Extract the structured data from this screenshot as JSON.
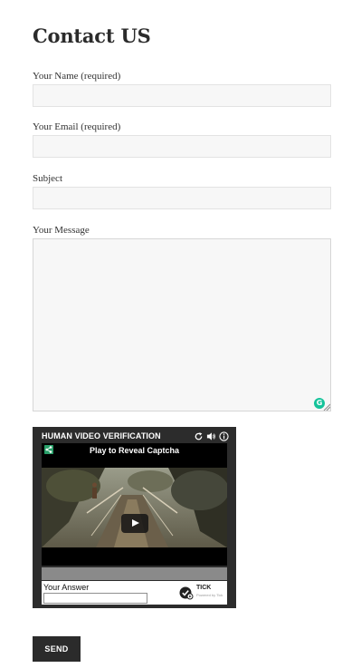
{
  "page": {
    "title": "Contact US"
  },
  "form": {
    "name": {
      "label": "Your Name (required)",
      "value": ""
    },
    "email": {
      "label": "Your Email (required)",
      "value": ""
    },
    "subject": {
      "label": "Subject",
      "value": ""
    },
    "message": {
      "label": "Your Message",
      "value": ""
    },
    "send_label": "SEND"
  },
  "captcha": {
    "title": "HUMAN VIDEO VERIFICATION",
    "caption": "Play to Reveal Captcha",
    "answer_label": "Your Answer",
    "answer_value": "",
    "brand": "TICK",
    "brand_sub": "Powered by Tick",
    "controls": [
      "refresh-icon",
      "speaker-icon",
      "info-icon"
    ]
  },
  "colors": {
    "button_bg": "#2b2b2b",
    "field_bg": "#f7f7f7",
    "captcha_bg": "#2c2c2c",
    "grammarly": "#15c39a"
  }
}
